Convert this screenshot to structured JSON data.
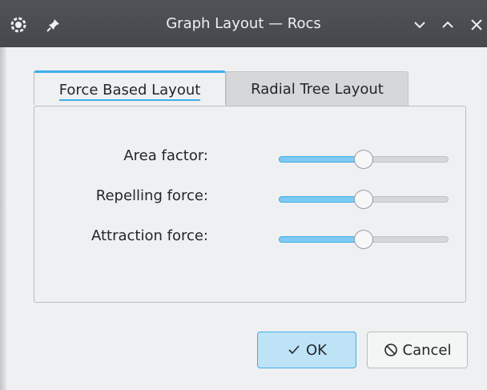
{
  "window": {
    "title": "Graph Layout — Rocs"
  },
  "tabs": [
    {
      "label": "Force Based Layout",
      "active": true
    },
    {
      "label": "Radial Tree Layout",
      "active": false
    }
  ],
  "settings": [
    {
      "label": "Area factor:",
      "value_fraction": 0.5
    },
    {
      "label": "Repelling force:",
      "value_fraction": 0.5
    },
    {
      "label": "Attraction force:",
      "value_fraction": 0.5
    }
  ],
  "buttons": {
    "ok": "OK",
    "cancel": "Cancel"
  },
  "colors": {
    "accent": "#3daee9",
    "titlebar": "#475057",
    "background": "#eff0f1"
  },
  "icons": {
    "app": "rocs-app-icon",
    "pin": "pin-icon",
    "minimize": "chevron-down-icon",
    "maximize": "chevron-up-icon",
    "close": "close-icon",
    "ok": "checkmark-icon",
    "cancel": "cancel-icon"
  }
}
